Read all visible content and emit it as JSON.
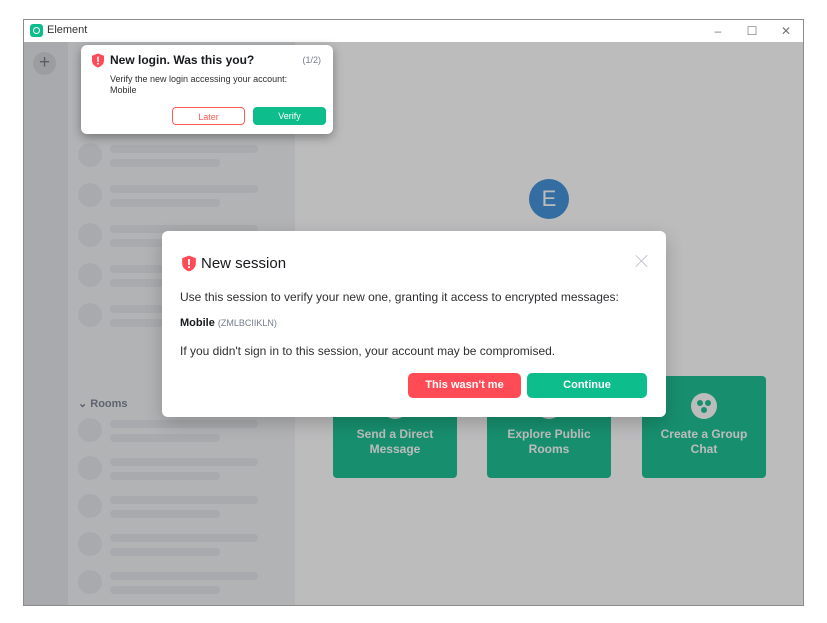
{
  "window": {
    "title": "Element",
    "controls": {
      "minimize": "–",
      "maximize": "☐",
      "close": "✕"
    }
  },
  "spaces": {
    "add_label": "+"
  },
  "room_list": {
    "rooms_header": "⌄ Rooms"
  },
  "main": {
    "avatar_letter": "E",
    "actions": [
      {
        "label": "Send a Direct Message"
      },
      {
        "label": "Explore Public Rooms"
      },
      {
        "label": "Create a Group Chat"
      }
    ]
  },
  "toast": {
    "title": "New login. Was this you?",
    "counter": "(1/2)",
    "description": "Verify the new login accessing your account: Mobile",
    "later_label": "Later",
    "verify_label": "Verify"
  },
  "dialog": {
    "title": "New session",
    "message": "Use this session to verify your new one, granting it access to encrypted messages:",
    "device_name": "Mobile",
    "device_id": "(ZMLBCIIKLN)",
    "warning": "If you didn't sign in to this session, your account may be compromised.",
    "reject_label": "This wasn't me",
    "continue_label": "Continue"
  },
  "colors": {
    "accent": "#0dbd8b",
    "danger": "#ff4b55",
    "avatar": "#368bd6"
  },
  "icons": {
    "app": "element-logo-icon",
    "shield": "shield-warning-icon",
    "close": "close-icon",
    "group": "group-chat-icon"
  }
}
